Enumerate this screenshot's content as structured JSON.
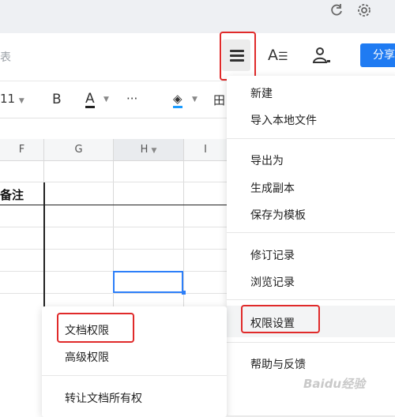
{
  "title_fragment": "表",
  "share_label": "分享",
  "toolbar": {
    "font_size": "11",
    "bold": "B",
    "font_color": "A",
    "more": "···",
    "fill_color": "◈",
    "border": "田",
    "accent_color": "#1f7bf2",
    "fill_underline_color": "#1a9bff"
  },
  "columns": [
    "F",
    "G",
    "H",
    "I"
  ],
  "cell_text": "备注",
  "menu": {
    "items": [
      "新建",
      "导入本地文件",
      "导出为",
      "生成副本",
      "保存为模板",
      "修订记录",
      "浏览记录",
      "权限设置",
      "帮助与反馈"
    ]
  },
  "submenu": {
    "items": [
      "文档权限",
      "高级权限",
      "转让文档所有权"
    ]
  },
  "watermark": "Baidu经验"
}
